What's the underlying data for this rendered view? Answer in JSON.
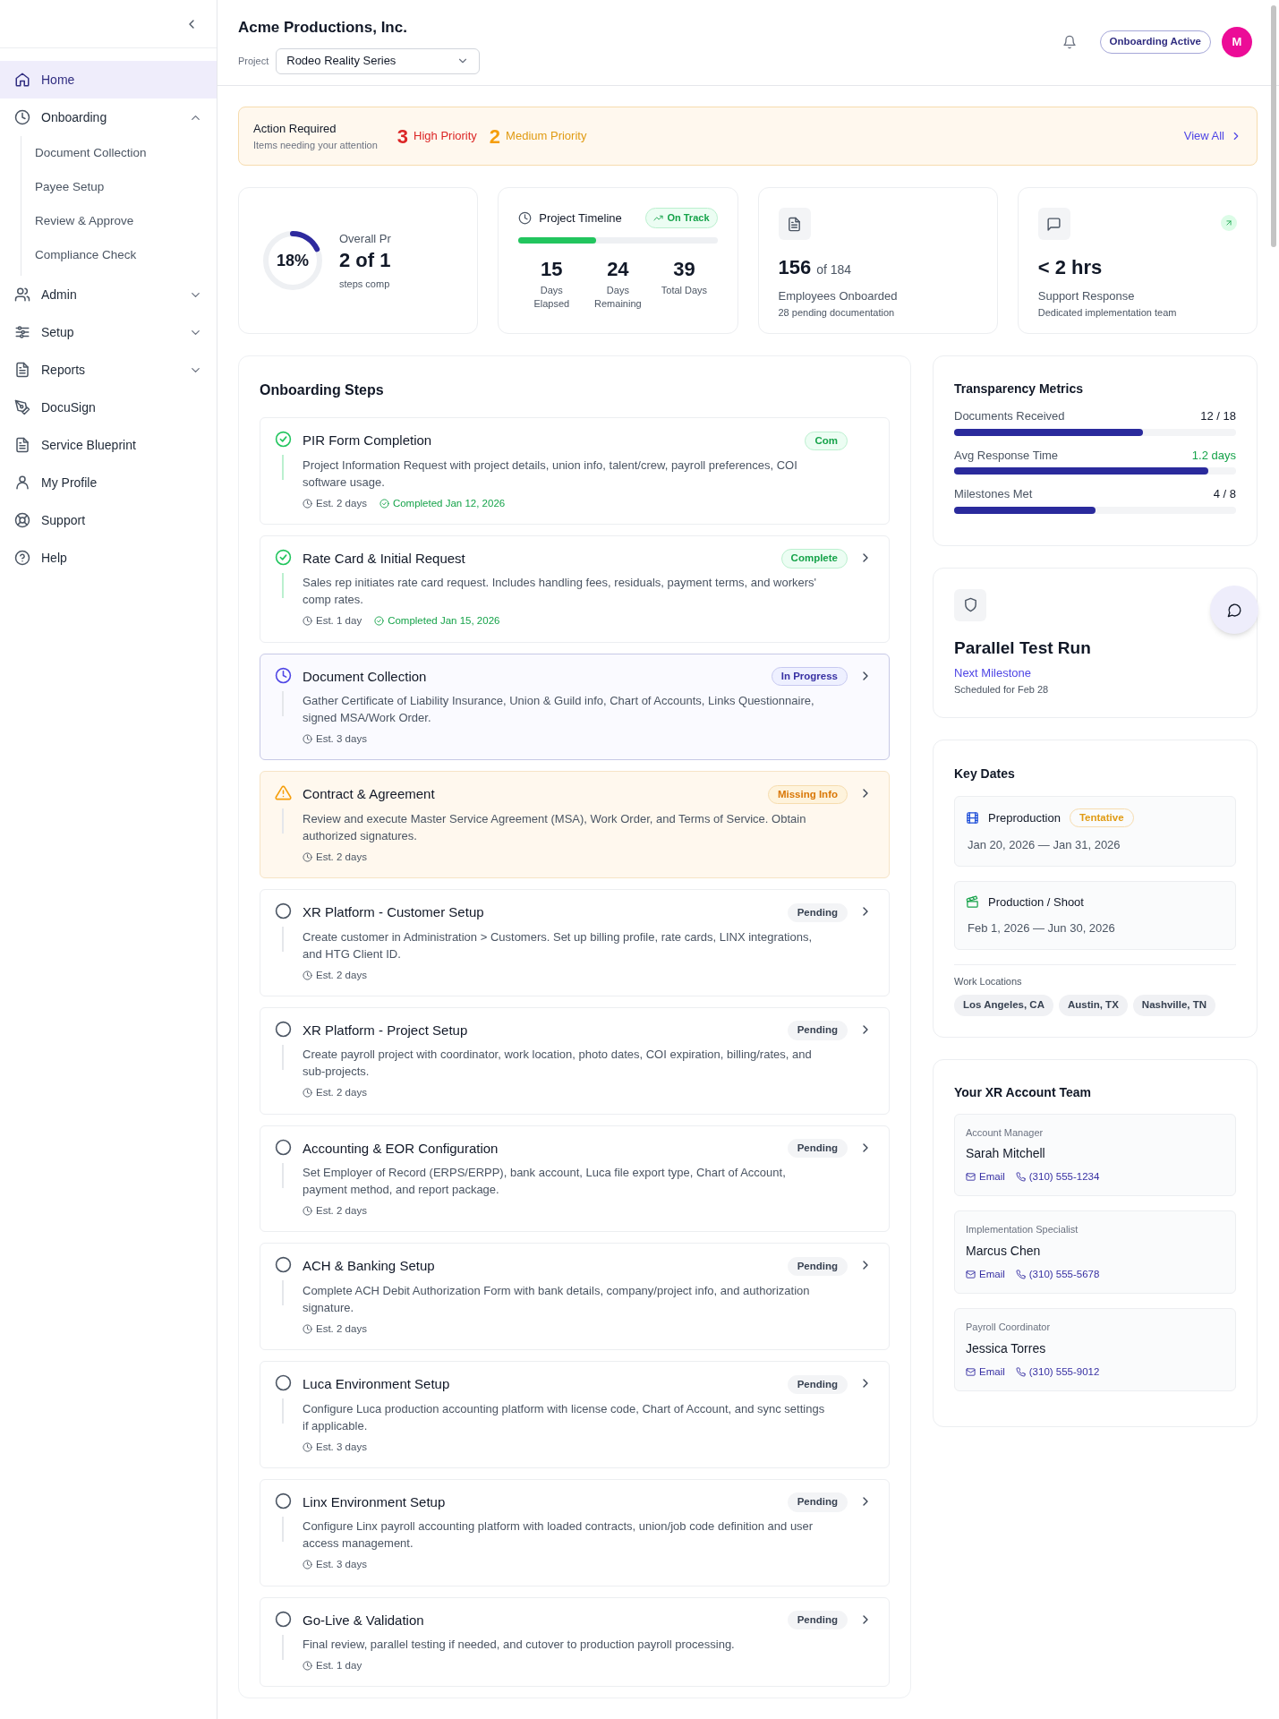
{
  "sidebar": {
    "items": [
      {
        "label": "Home",
        "selected": true
      },
      {
        "label": "Onboarding",
        "selected": false,
        "expanded": true,
        "children": [
          {
            "label": "Document Collection"
          },
          {
            "label": "Payee Setup"
          },
          {
            "label": "Review & Approve"
          },
          {
            "label": "Compliance Check"
          }
        ]
      },
      {
        "label": "Admin",
        "selected": false,
        "expanded": false
      },
      {
        "label": "Setup",
        "selected": false,
        "expanded": false
      },
      {
        "label": "Reports",
        "selected": false,
        "expanded": false
      },
      {
        "label": "DocuSign",
        "selected": false
      },
      {
        "label": "Service Blueprint",
        "selected": false
      },
      {
        "label": "My Profile",
        "selected": false
      },
      {
        "label": "Support",
        "selected": false
      },
      {
        "label": "Help",
        "selected": false
      }
    ]
  },
  "header": {
    "company": "Acme Productions, Inc.",
    "project_label": "Project",
    "project": "Rodeo Reality Series",
    "status_badge": "Onboarding Active",
    "avatar": "M"
  },
  "action_banner": {
    "title": "Action Required",
    "subtitle": "Items needing your attention",
    "high_count": "3",
    "high_label": "High Priority",
    "medium_count": "2",
    "medium_label": "Medium Priority",
    "link": "View All"
  },
  "stats": {
    "progress": {
      "level": 0.18,
      "percent": "18%",
      "label": "Overall Pr",
      "value": "2 of 1",
      "caption": "steps comp"
    },
    "timeline": {
      "title": "Project Timeline",
      "badge": "On Track",
      "level": 0.39,
      "figures": [
        {
          "value": "15",
          "label": "Days Elapsed"
        },
        {
          "value": "24",
          "label": "Days Remaining"
        },
        {
          "value": "39",
          "label": "Total Days"
        }
      ]
    },
    "employees": {
      "value": "156",
      "of": "of 184",
      "label": "Employees Onboarded",
      "caption": "28 pending documentation"
    },
    "support": {
      "value": "< 2 hrs",
      "label": "Support Response",
      "caption": "Dedicated implementation team"
    }
  },
  "steps": {
    "title": "Onboarding Steps",
    "items": [
      {
        "kind": "complete",
        "title": "PIR Form Completion",
        "description": "Project Information Request with project details, union info, talent/crew, payroll preferences, COI software usage.",
        "est": "Est. 2 days",
        "completed": "Completed Jan 12, 2026",
        "badge": "Com",
        "chevron": false
      },
      {
        "kind": "complete",
        "title": "Rate Card & Initial Request",
        "description": "Sales rep initiates rate card request. Includes handling fees, residuals, payment terms, and workers' comp rates.",
        "est": "Est. 1 day",
        "completed": "Completed Jan 15, 2026",
        "badge": "Complete",
        "chevron": true
      },
      {
        "kind": "in_progress",
        "title": "Document Collection",
        "description": "Gather Certificate of Liability Insurance, Union & Guild info, Chart of Accounts, Links Questionnaire, signed MSA/Work Order.",
        "est": "Est. 3 days",
        "badge": "In Progress",
        "chevron": true
      },
      {
        "kind": "missing",
        "title": "Contract & Agreement",
        "description": "Review and execute Master Service Agreement (MSA), Work Order, and Terms of Service. Obtain authorized signatures.",
        "est": "Est. 2 days",
        "badge": "Missing Info",
        "chevron": true
      },
      {
        "kind": "pending",
        "title": "XR Platform - Customer Setup",
        "description": "Create customer in Administration > Customers. Set up billing profile, rate cards, LINX integrations, and HTG Client ID.",
        "est": "Est. 2 days",
        "badge": "Pending",
        "chevron": true
      },
      {
        "kind": "pending",
        "title": "XR Platform - Project Setup",
        "description": "Create payroll project with coordinator, work location, photo dates, COI expiration, billing/rates, and sub-projects.",
        "est": "Est. 2 days",
        "badge": "Pending",
        "chevron": true
      },
      {
        "kind": "pending",
        "title": "Accounting & EOR Configuration",
        "description": "Set Employer of Record (ERPS/ERPP), bank account, Luca file export type, Chart of Account, payment method, and report package.",
        "est": "Est. 2 days",
        "badge": "Pending",
        "chevron": true
      },
      {
        "kind": "pending",
        "title": "ACH & Banking Setup",
        "description": "Complete ACH Debit Authorization Form with bank details, company/project info, and authorization signature.",
        "est": "Est. 2 days",
        "badge": "Pending",
        "chevron": true
      },
      {
        "kind": "pending",
        "title": "Luca Environment Setup",
        "description": "Configure Luca production accounting platform with license code, Chart of Account, and sync settings if applicable.",
        "est": "Est. 3 days",
        "badge": "Pending",
        "chevron": true
      },
      {
        "kind": "pending",
        "title": "Linx Environment Setup",
        "description": "Configure Linx payroll accounting platform with loaded contracts, union/job code definition and user access management.",
        "est": "Est. 3 days",
        "badge": "Pending",
        "chevron": true
      },
      {
        "kind": "pending",
        "title": "Go-Live & Validation",
        "description": "Final review, parallel testing if needed, and cutover to production payroll processing.",
        "est": "Est. 1 day",
        "badge": "Pending",
        "chevron": true
      }
    ]
  },
  "metrics": {
    "title": "Transparency Metrics",
    "items": [
      {
        "label": "Documents Received",
        "value": "12 / 18",
        "level": 0.67,
        "good": false
      },
      {
        "label": "Avg Response Time",
        "value": "1.2 days",
        "level": 0.9,
        "good": true
      },
      {
        "label": "Milestones Met",
        "value": "4 / 8",
        "level": 0.5,
        "good": false
      }
    ]
  },
  "milestone": {
    "title": "Parallel Test Run",
    "label": "Next Milestone",
    "caption": "Scheduled for Feb 28"
  },
  "key_dates": {
    "title": "Key Dates",
    "items": [
      {
        "kind": "film",
        "title": "Preproduction",
        "badge": "Tentative",
        "range": "Jan 20, 2026 — Jan 31, 2026"
      },
      {
        "kind": "clapper",
        "title": "Production / Shoot",
        "range": "Feb 1, 2026 — Jun 30, 2026"
      }
    ],
    "locations_label": "Work Locations",
    "locations": [
      "Los Angeles, CA",
      "Austin, TX",
      "Nashville, TN"
    ]
  },
  "team": {
    "title": "Your XR Account Team",
    "members": [
      {
        "role": "Account Manager",
        "name": "Sarah Mitchell",
        "email": "Email",
        "phone": "(310) 555-1234"
      },
      {
        "role": "Implementation Specialist",
        "name": "Marcus Chen",
        "email": "Email",
        "phone": "(310) 555-5678"
      },
      {
        "role": "Payroll Coordinator",
        "name": "Jessica Torres",
        "email": "Email",
        "phone": "(310) 555-9012"
      }
    ]
  }
}
